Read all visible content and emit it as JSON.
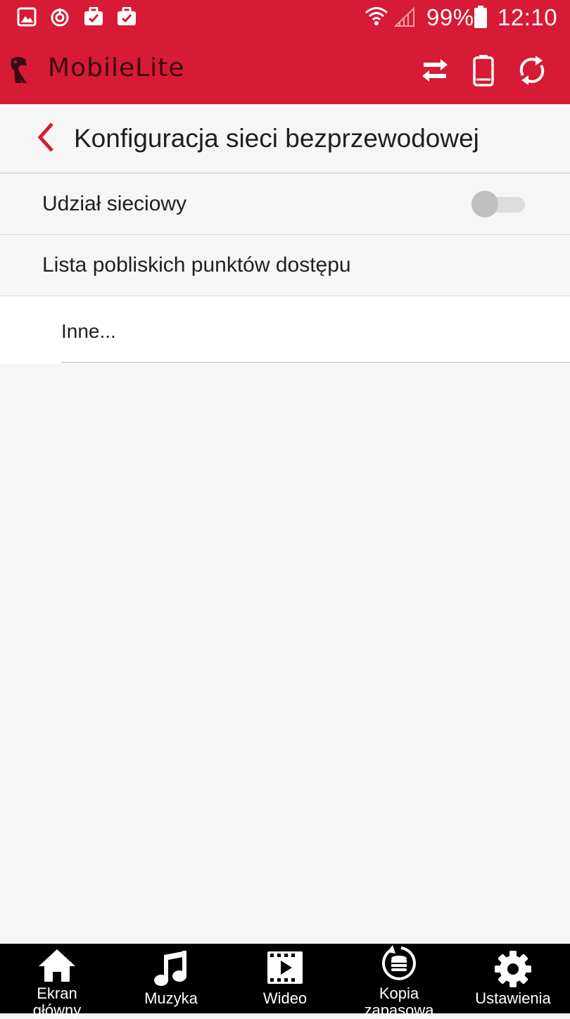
{
  "status_bar": {
    "battery_percent": "99%",
    "time": "12:10",
    "icons": [
      "gallery-icon",
      "sync-icon",
      "briefcase-check-icon",
      "briefcase-check-icon",
      "wifi-icon",
      "signal-icon",
      "battery-icon"
    ]
  },
  "app_bar": {
    "brand_name": "MobileLite",
    "actions": [
      "transfer-icon",
      "device-icon",
      "refresh-icon"
    ]
  },
  "page": {
    "title": "Konfiguracja sieci bezprzewodowej"
  },
  "settings": {
    "network_share_label": "Udział sieciowy",
    "network_share_enabled": false,
    "nearby_hotspots_label": "Lista pobliskich punktów dostępu",
    "other_label": "Inne..."
  },
  "bottom_nav": {
    "items": [
      {
        "label_line1": "Ekran",
        "label_line2": "główny",
        "icon": "home-icon"
      },
      {
        "label_line1": "Muzyka",
        "icon": "music-icon"
      },
      {
        "label_line1": "Wideo",
        "icon": "video-icon"
      },
      {
        "label_line1": "Kopia",
        "label_line2": "zapasowa",
        "icon": "backup-icon"
      },
      {
        "label_line1": "Ustawienia",
        "icon": "gear-icon"
      }
    ]
  },
  "colors": {
    "brand_red": "#d71a35",
    "background": "#f6f6f6",
    "nav_background": "#000000"
  }
}
